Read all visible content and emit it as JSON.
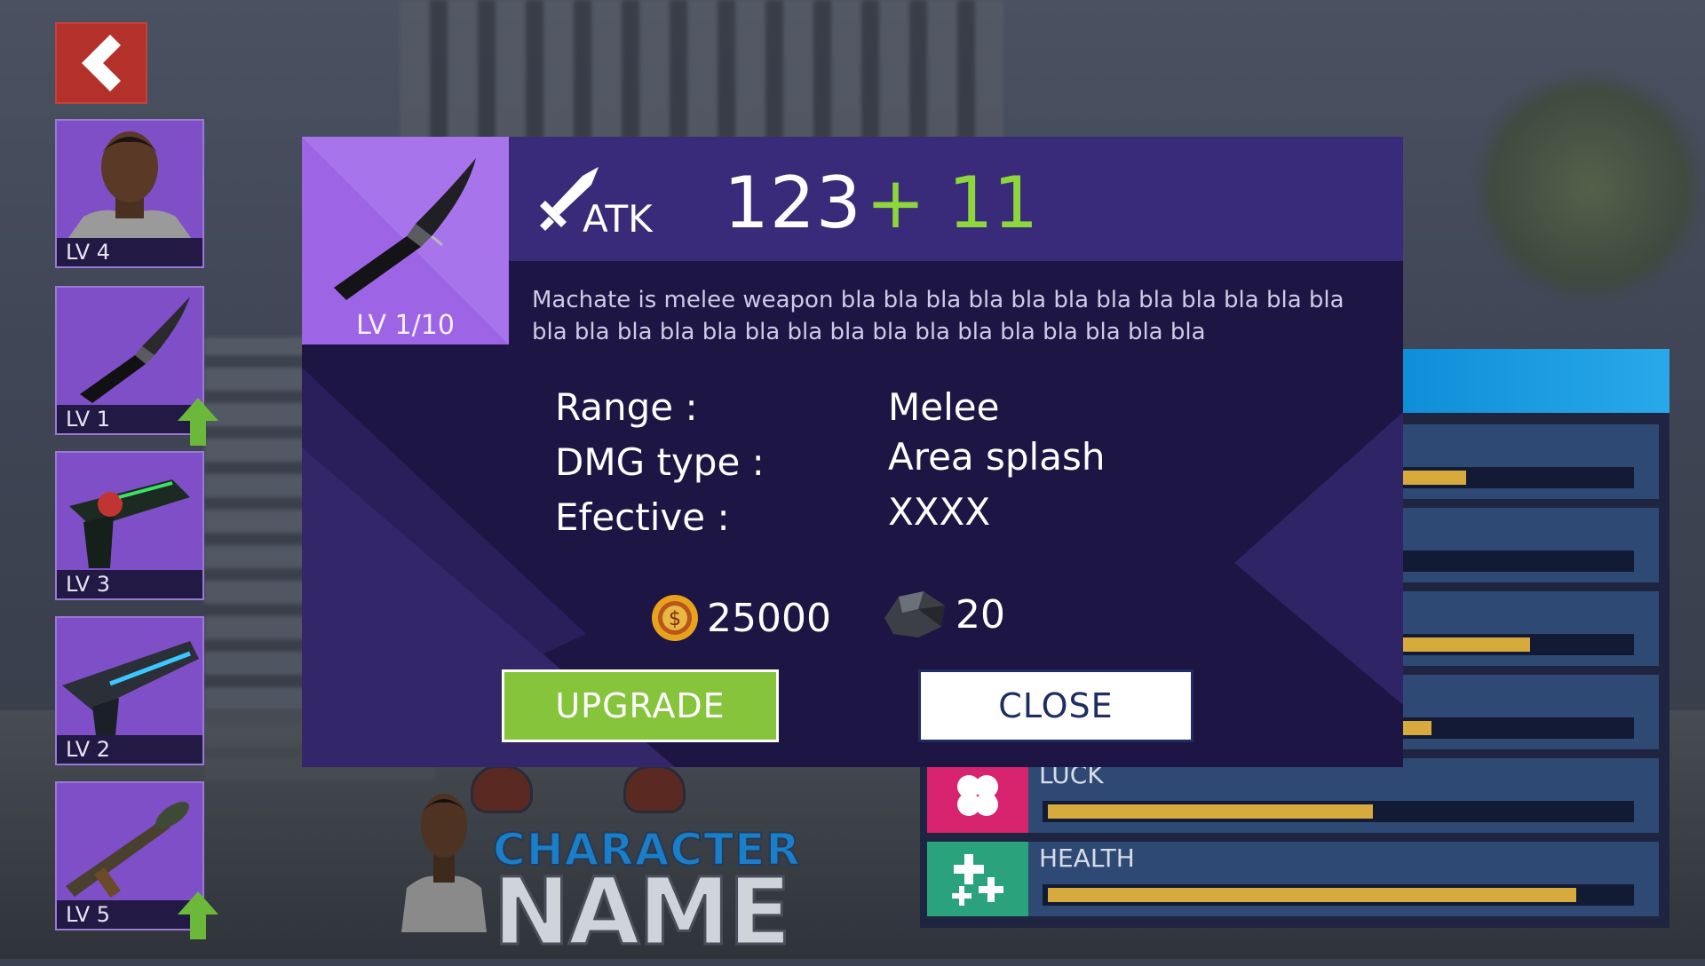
{
  "back_button": {
    "icon": "chevron-left-icon"
  },
  "inventory": [
    {
      "type": "character",
      "level": "LV 4",
      "upgrade": false
    },
    {
      "type": "knife",
      "level": "LV 1",
      "upgrade": true
    },
    {
      "type": "laser-pistol",
      "level": "LV 3",
      "upgrade": false
    },
    {
      "type": "plasma-rifle",
      "level": "LV 2",
      "upgrade": false
    },
    {
      "type": "rocket-launcher",
      "level": "LV 5",
      "upgrade": true
    }
  ],
  "modal": {
    "item_level": "LV 1/10",
    "stat_label": "ATK",
    "stat_value": "123",
    "stat_bonus": "+ 11",
    "description": "Machate is melee weapon bla bla bla bla bla bla bla bla bla bla bla bla bla bla bla bla bla bla bla bla bla bla bla bla bla bla bla bla",
    "properties": [
      {
        "label": "Range :",
        "value": "Melee"
      },
      {
        "label": "DMG type :",
        "value": "Area splash"
      },
      {
        "label": "Efective :",
        "value": "XXXX"
      }
    ],
    "cost_coins": "25000",
    "cost_ore": "20",
    "upgrade_label": "UPGRADE",
    "close_label": "CLOSE"
  },
  "stats": [
    {
      "label": "",
      "fill": 0.72
    },
    {
      "label": "",
      "fill": 0.0
    },
    {
      "label": "",
      "fill": 0.83
    },
    {
      "label": "",
      "fill": 0.66
    },
    {
      "label": "LUCK",
      "fill": 0.56,
      "color": "#d8236f",
      "icon": "clover-icon"
    },
    {
      "label": "HEALTH",
      "fill": 0.91,
      "color": "#2aa37d",
      "icon": "health-plus-icon"
    }
  ],
  "character": {
    "title": "CHARACTER",
    "name": "NAME"
  },
  "colors": {
    "accent_purple": "#9d65e6",
    "modal_bg": "#1d1644",
    "upgrade_green": "#85c43b",
    "bonus_green": "#8dd63b",
    "bar_gold": "#d6aa3d"
  }
}
